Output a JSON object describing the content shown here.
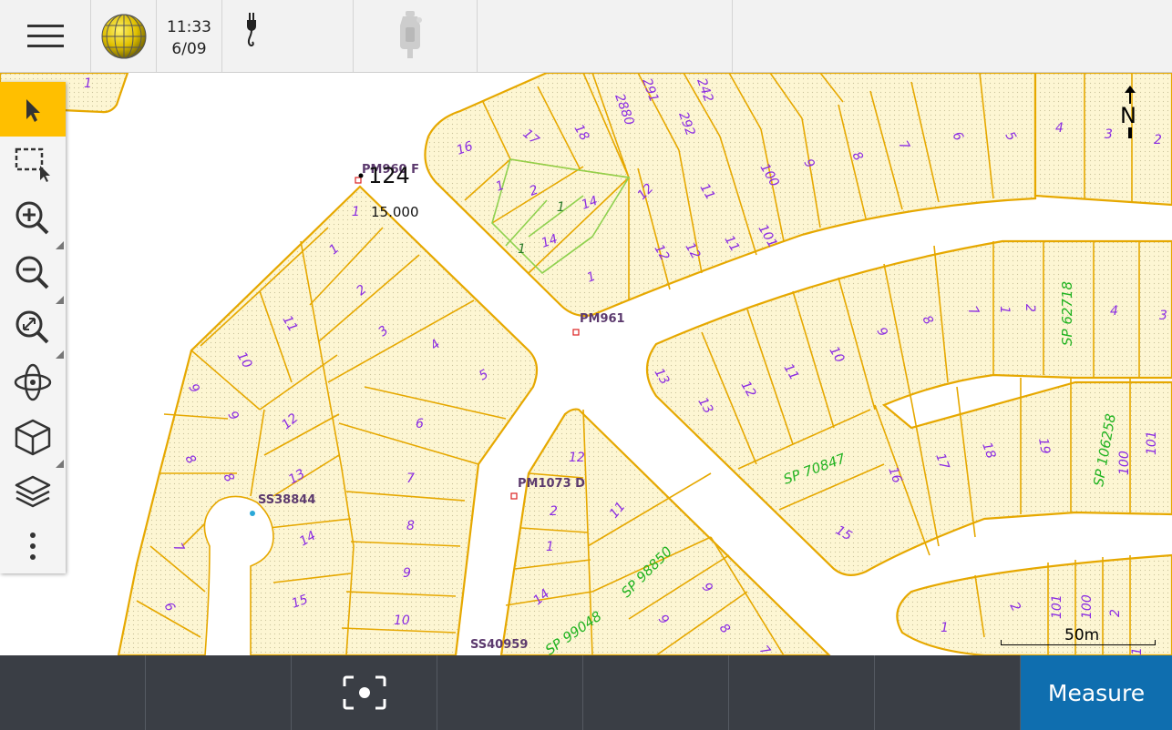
{
  "header": {
    "time": "11:33",
    "date": "6/09",
    "menu_icon": "hamburger-icon",
    "globe_icon": "globe-icon",
    "power_icon": "power-plug-icon",
    "receiver_icon": "gnss-receiver-icon"
  },
  "map": {
    "point_name": "124",
    "point_height": "15.000",
    "marks": [
      "PM960 F",
      "PM961",
      "PM1073 D",
      "SS38844",
      "SS40959"
    ],
    "strata_plans": [
      "SP 62718",
      "SP 106258",
      "SP 70847",
      "SP 98850",
      "SP 99048"
    ],
    "north_label": "N",
    "scale_label": "50m",
    "lot_numbers": [
      "1",
      "16",
      "17",
      "18",
      "2880",
      "291",
      "292",
      "242",
      "1",
      "2",
      "14",
      "14",
      "1",
      "1",
      "12",
      "11",
      "12",
      "12",
      "11",
      "101",
      "100",
      "9",
      "8",
      "7",
      "6",
      "5",
      "4",
      "3",
      "2",
      "1",
      "1",
      "2",
      "11",
      "10",
      "9",
      "8",
      "12",
      "13",
      "14",
      "15",
      "10",
      "9",
      "8",
      "7",
      "6",
      "3",
      "4",
      "5",
      "6",
      "7",
      "8",
      "9",
      "10",
      "12",
      "11",
      "2",
      "1",
      "14",
      "9",
      "8",
      "7",
      "13",
      "12",
      "11",
      "10",
      "9",
      "8",
      "7",
      "13",
      "16",
      "17",
      "18",
      "19",
      "4",
      "3",
      "100",
      "101",
      "15",
      "1",
      "2",
      "101",
      "100",
      "2",
      "1",
      "1"
    ]
  },
  "toolbar": {
    "tools": [
      "select-arrow-icon",
      "box-select-icon",
      "zoom-in-icon",
      "zoom-out-icon",
      "zoom-extents-icon",
      "orbit-icon",
      "3d-cube-icon",
      "layers-icon",
      "more-vertical-icon"
    ]
  },
  "footer": {
    "measure_label": "Measure",
    "capture_icon": "camera-capture-icon"
  },
  "colors": {
    "parcel_fill": "#fdf6d3",
    "parcel_line": "#e6a800",
    "lot_number": "#8a2be2",
    "strata_label": "#21b321",
    "measure_button": "#0f6eaf",
    "toolbar_active": "#ffbf00"
  }
}
